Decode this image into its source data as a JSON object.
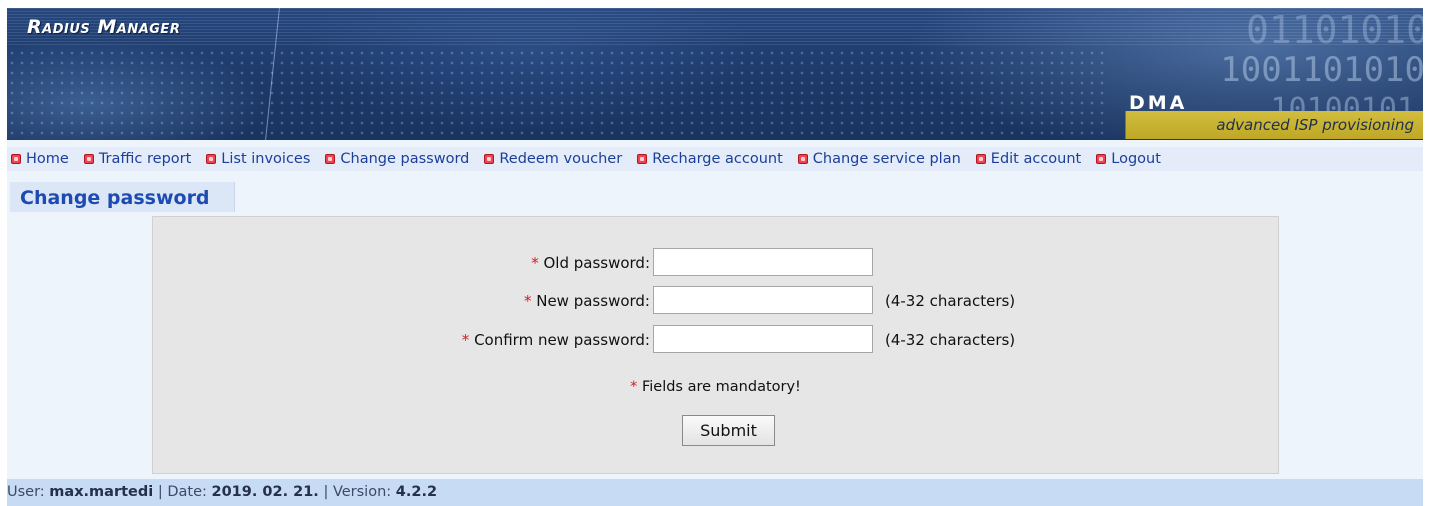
{
  "header": {
    "brand": "Radius Manager",
    "logo_text": "DMA",
    "tagline": "advanced ISP provisioning",
    "binary_lines": [
      "01101010",
      "1001101010",
      "10100101"
    ]
  },
  "nav": {
    "items": [
      {
        "label": "Home"
      },
      {
        "label": "Traffic report"
      },
      {
        "label": "List invoices"
      },
      {
        "label": "Change password"
      },
      {
        "label": "Redeem voucher"
      },
      {
        "label": "Recharge account"
      },
      {
        "label": "Change service plan"
      },
      {
        "label": "Edit account"
      },
      {
        "label": "Logout"
      }
    ]
  },
  "page": {
    "title": "Change password"
  },
  "form": {
    "required_marker": "*",
    "fields": [
      {
        "label": "Old password:",
        "value": "",
        "hint": ""
      },
      {
        "label": "New password:",
        "value": "",
        "hint": "(4-32 characters)"
      },
      {
        "label": "Confirm new password:",
        "value": "",
        "hint": "(4-32 characters)"
      }
    ],
    "mandatory_note": "Fields are mandatory!",
    "submit_label": "Submit"
  },
  "footer": {
    "user_label": "User:",
    "user": "max.martedi",
    "date_label": "Date:",
    "date": "2019. 02. 21.",
    "version_label": "Version:",
    "version": "4.2.2",
    "separator": "|"
  },
  "colors": {
    "banner": "#1c3866",
    "nav_link": "#1b3f9a",
    "bullet": "#ee4550",
    "title": "#1e4bb2",
    "tagline_bg": "#c9b333",
    "footer_bg": "#c8dbf5",
    "required": "#d9191f"
  }
}
